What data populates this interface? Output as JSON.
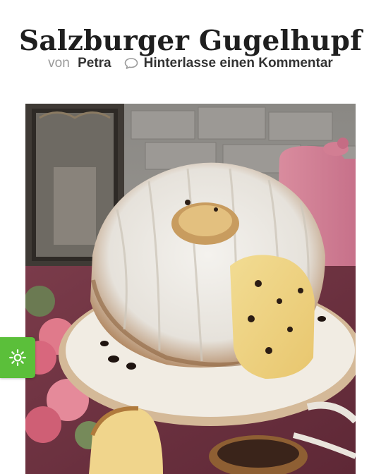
{
  "post": {
    "title": "Salzburger Gugelhupf",
    "by_label": "von",
    "author": "Petra",
    "comment_label": "Hinterlasse einen Kommentar"
  },
  "icons": {
    "comment": "speech-bubble-icon",
    "settings": "gear-icon"
  },
  "colors": {
    "settings_button": "#5bbf3a",
    "meta_muted": "#9a9a9a"
  }
}
